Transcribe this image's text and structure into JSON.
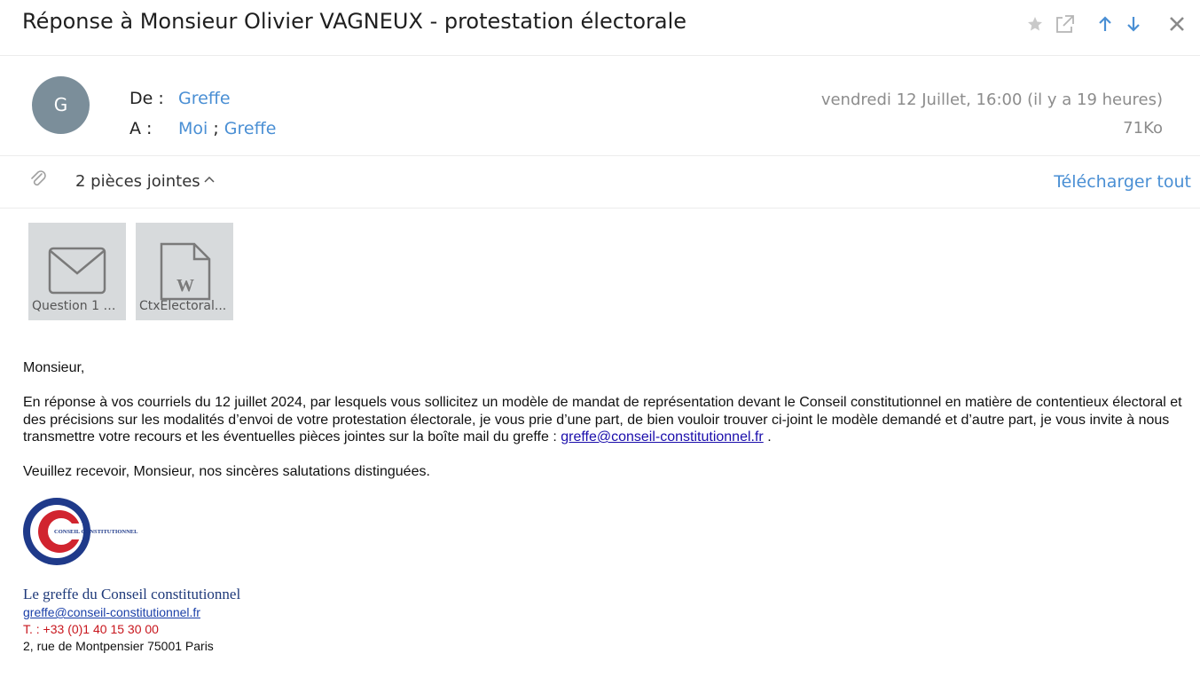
{
  "email": {
    "subject": "Réponse à Monsieur Olivier VAGNEUX - protestation électorale",
    "avatar_letter": "G",
    "from_label": "De :",
    "from": "Greffe",
    "to_label": "A :",
    "to_1": "Moi",
    "to_sep": ";",
    "to_2": "Greffe",
    "date": "vendredi 12 Juillet, 16:00 (il y a 19 heures)",
    "size": "71Ko"
  },
  "toolbar_icons": [
    "star-icon",
    "popout-icon",
    "arrow-up-icon",
    "arrow-down-icon",
    "close-icon"
  ],
  "attachments": {
    "count_label": "2 pièces jointes",
    "download_all": "Télécharger tout",
    "items": [
      {
        "name": "Question 1 O...",
        "icon": "envelope-icon"
      },
      {
        "name": "CtxElectoral...",
        "icon": "word-document-icon"
      }
    ]
  },
  "body": {
    "greeting": "Monsieur,",
    "paragraph": "En réponse à vos courriels du 12 juillet 2024, par lesquels vous sollicitez un modèle de mandat de représentation devant le Conseil constitutionnel en matière de contentieux électoral et des précisions sur les modalités d’envoi de votre protestation électorale, je vous prie d’une part, de bien vouloir trouver ci-joint le modèle demandé et d’autre part, je vous invite à nous transmettre votre recours et les éventuelles pièces jointes sur la boîte mail du greffe  : ",
    "email_link": "greffe@conseil-constitutionnel.fr",
    "paragraph_end": " .",
    "closing": "Veuillez recevoir, Monsieur, nos sincères salutations distinguées."
  },
  "signature": {
    "logo_text": "CONSEIL CONSTITUTIONNEL",
    "name": "Le greffe du Conseil constitutionnel",
    "email": "greffe@conseil-constitutionnel.fr",
    "phone": "T. : +33 (0)1 40 15 30 00",
    "address": "2, rue de Montpensier 75001 Paris"
  },
  "colors": {
    "link": "#4a8fd4",
    "avatar": "#7b8e9a",
    "logo_blue": "#1f3a8a",
    "logo_red": "#d1242f"
  }
}
